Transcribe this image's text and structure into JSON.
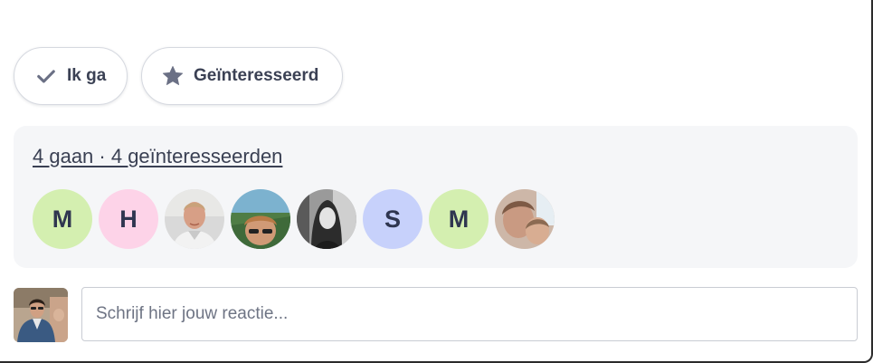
{
  "rsvp": {
    "going_label": "Ik ga",
    "going_icon": "checkmark-icon",
    "interested_label": "Geïnteresseerd",
    "interested_icon": "star-icon"
  },
  "attendees": {
    "summary": "4 gaan · 4 geïnteresseerden",
    "list": [
      {
        "type": "initial",
        "initial": "M",
        "color": "#d4efb0"
      },
      {
        "type": "initial",
        "initial": "H",
        "color": "#fdd3e8"
      },
      {
        "type": "photo",
        "icon": "person-photo-icon"
      },
      {
        "type": "photo",
        "icon": "person-photo-icon"
      },
      {
        "type": "photo",
        "icon": "person-photo-icon"
      },
      {
        "type": "initial",
        "initial": "S",
        "color": "#c7d1fb"
      },
      {
        "type": "initial",
        "initial": "M",
        "color": "#d4efb0"
      },
      {
        "type": "photo",
        "icon": "person-photo-icon"
      }
    ]
  },
  "comment": {
    "placeholder": "Schrijf hier jouw reactie..."
  },
  "colors": {
    "icon_gray": "#6b7085",
    "panel_bg": "#f5f6f8"
  }
}
